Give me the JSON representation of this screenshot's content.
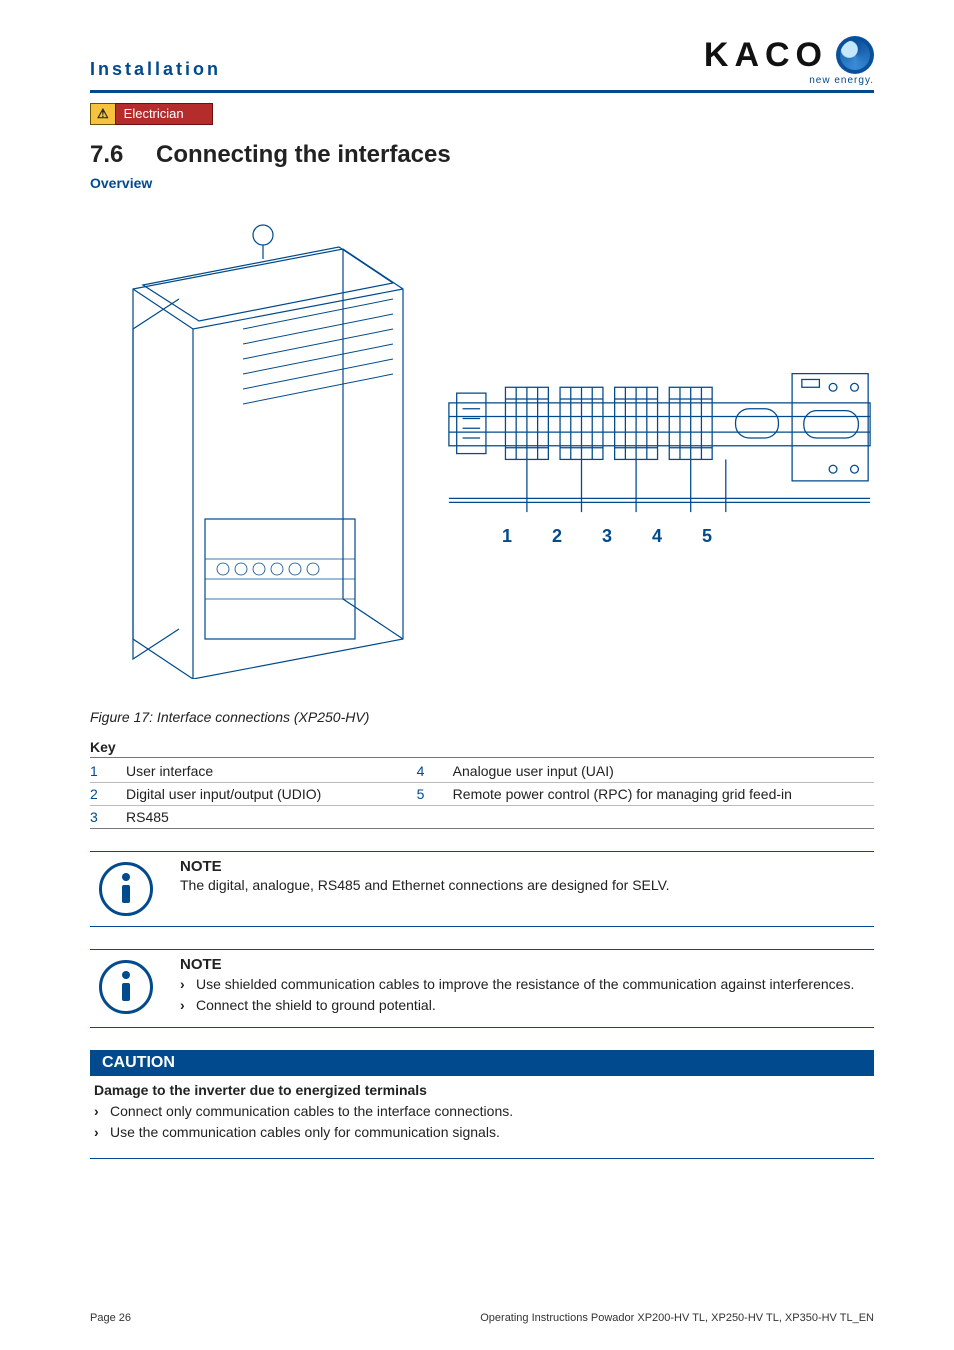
{
  "header": {
    "section": "Installation",
    "logo_text": "KACO",
    "logo_sub": "new energy."
  },
  "role_badge": {
    "warn_symbol": "⚠",
    "role": "Electrician"
  },
  "section": {
    "number": "7.6",
    "title": "Connecting the interfaces"
  },
  "overview_label": "Overview",
  "figure": {
    "callouts": [
      "1",
      "2",
      "3",
      "4",
      "5"
    ],
    "caption": "Figure 17:  Interface connections (XP250-HV)"
  },
  "key": {
    "heading": "Key",
    "rows_left": [
      {
        "n": "1",
        "t": "User interface"
      },
      {
        "n": "2",
        "t": "Digital user input/output (UDIO)"
      },
      {
        "n": "3",
        "t": "RS485"
      }
    ],
    "rows_right": [
      {
        "n": "4",
        "t": "Analogue user input (UAI)"
      },
      {
        "n": "5",
        "t": "Remote power control (RPC) for managing grid feed-in"
      },
      {
        "n": "",
        "t": ""
      }
    ]
  },
  "notes": [
    {
      "title": "NOTE",
      "text": "The digital, analogue, RS485 and Ethernet connections are designed for SELV."
    },
    {
      "title": "NOTE",
      "bullets": [
        "Use shielded communication cables to improve the resistance of the communication against interferences.",
        "Connect the shield to ground potential."
      ]
    }
  ],
  "caution": {
    "bar": "CAUTION",
    "sub": "Damage to the inverter due to energized terminals",
    "bullets": [
      "Connect only communication cables to the interface connections.",
      "Use the communication cables only for communication signals."
    ]
  },
  "footer": {
    "left": "Page 26",
    "right": "Operating Instructions Powador XP200-HV TL, XP250-HV TL, XP350-HV TL_EN"
  }
}
